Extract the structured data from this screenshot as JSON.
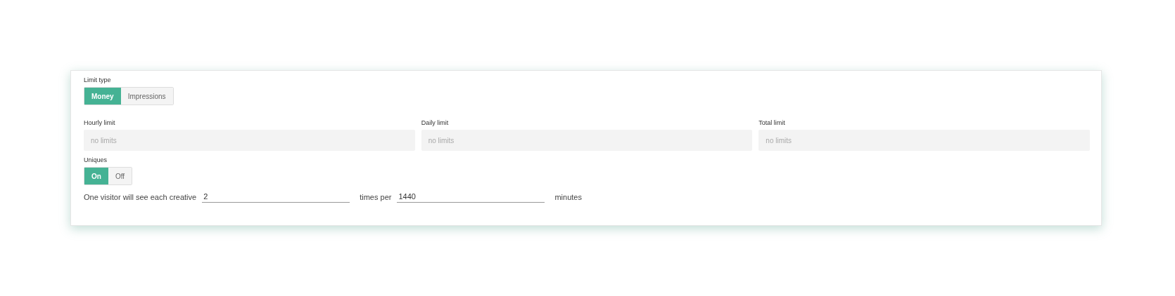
{
  "limit_type": {
    "label": "Limit type",
    "options": [
      {
        "label": "Money",
        "selected": true
      },
      {
        "label": "Impressions",
        "selected": false
      }
    ]
  },
  "limits": [
    {
      "label": "Hourly limit",
      "placeholder": "no limits"
    },
    {
      "label": "Daily limit",
      "placeholder": "no limits"
    },
    {
      "label": "Total limit",
      "placeholder": "no limits"
    }
  ],
  "uniques": {
    "label": "Uniques",
    "options": [
      {
        "label": "On",
        "selected": true
      },
      {
        "label": "Off",
        "selected": false
      }
    ]
  },
  "frequency": {
    "prefix": "One visitor will see each creative",
    "times": "2",
    "middle": "times per",
    "period": "1440",
    "suffix": "minutes"
  }
}
